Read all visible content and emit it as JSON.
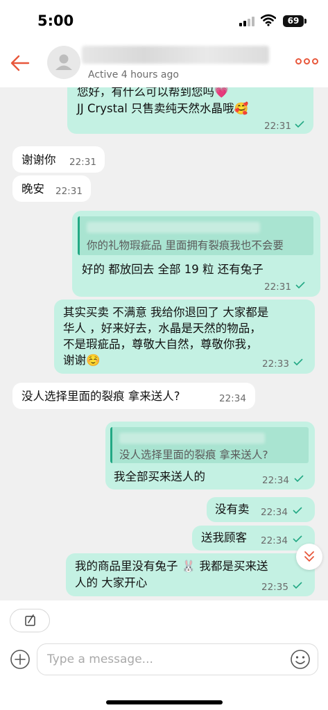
{
  "status_bar": {
    "time": "5:00",
    "battery": "69"
  },
  "header": {
    "contact_name": "████████████████",
    "contact_status": "Active 4 hours ago"
  },
  "messages": [
    {
      "direction": "out",
      "lines": [
        "您好，有什么可以帮到您吗💗",
        "JJ Crystal 只售卖纯天然水晶哦🥰"
      ],
      "time": "22:31"
    },
    {
      "direction": "in",
      "lines": [
        "谢谢你"
      ],
      "time": "22:31"
    },
    {
      "direction": "in",
      "lines": [
        "晚安"
      ],
      "time": "22:31"
    },
    {
      "direction": "out",
      "quote": {
        "author": "██████████",
        "text": "你的礼物瑕疵品 里面拥有裂痕我也不会要"
      },
      "lines": [
        "好的 都放回去 全部 19 粒 还有兔子"
      ],
      "time": "22:31"
    },
    {
      "direction": "out",
      "lines": [
        "其实买卖 不满意 我给你退回了 大家都是",
        "华人 ，好来好去，水晶是天然的物品，",
        "不是瑕疵品，尊敬大自然，尊敬你我，",
        "谢谢☺️"
      ],
      "time": "22:33"
    },
    {
      "direction": "in",
      "lines": [
        "没人选择里面的裂痕 拿来送人?"
      ],
      "time": "22:34"
    },
    {
      "direction": "out",
      "quote": {
        "author": "██████████",
        "text": "没人选择里面的裂痕 拿来送人?"
      },
      "lines": [
        "我全部买来送人的"
      ],
      "time": "22:34"
    },
    {
      "direction": "out",
      "lines": [
        "没有卖"
      ],
      "time": "22:34"
    },
    {
      "direction": "out",
      "lines": [
        "送我顾客"
      ],
      "time": "22:34"
    },
    {
      "direction": "out",
      "lines": [
        "我的商品里没有兔子 🐰 我都是买来送",
        "人的 大家开心"
      ],
      "time": "22:35"
    }
  ],
  "composer": {
    "placeholder": "Type a message..."
  },
  "colors": {
    "accent": "#e8573b",
    "outgoing_bubble": "#c4f1e3",
    "incoming_bubble": "#ffffff",
    "read_check": "#22a884"
  },
  "icons": [
    "back-arrow-icon",
    "avatar-placeholder-icon",
    "more-dots-icon",
    "double-chevron-down-icon",
    "edit-note-icon",
    "plus-circle-icon",
    "smiley-icon"
  ]
}
